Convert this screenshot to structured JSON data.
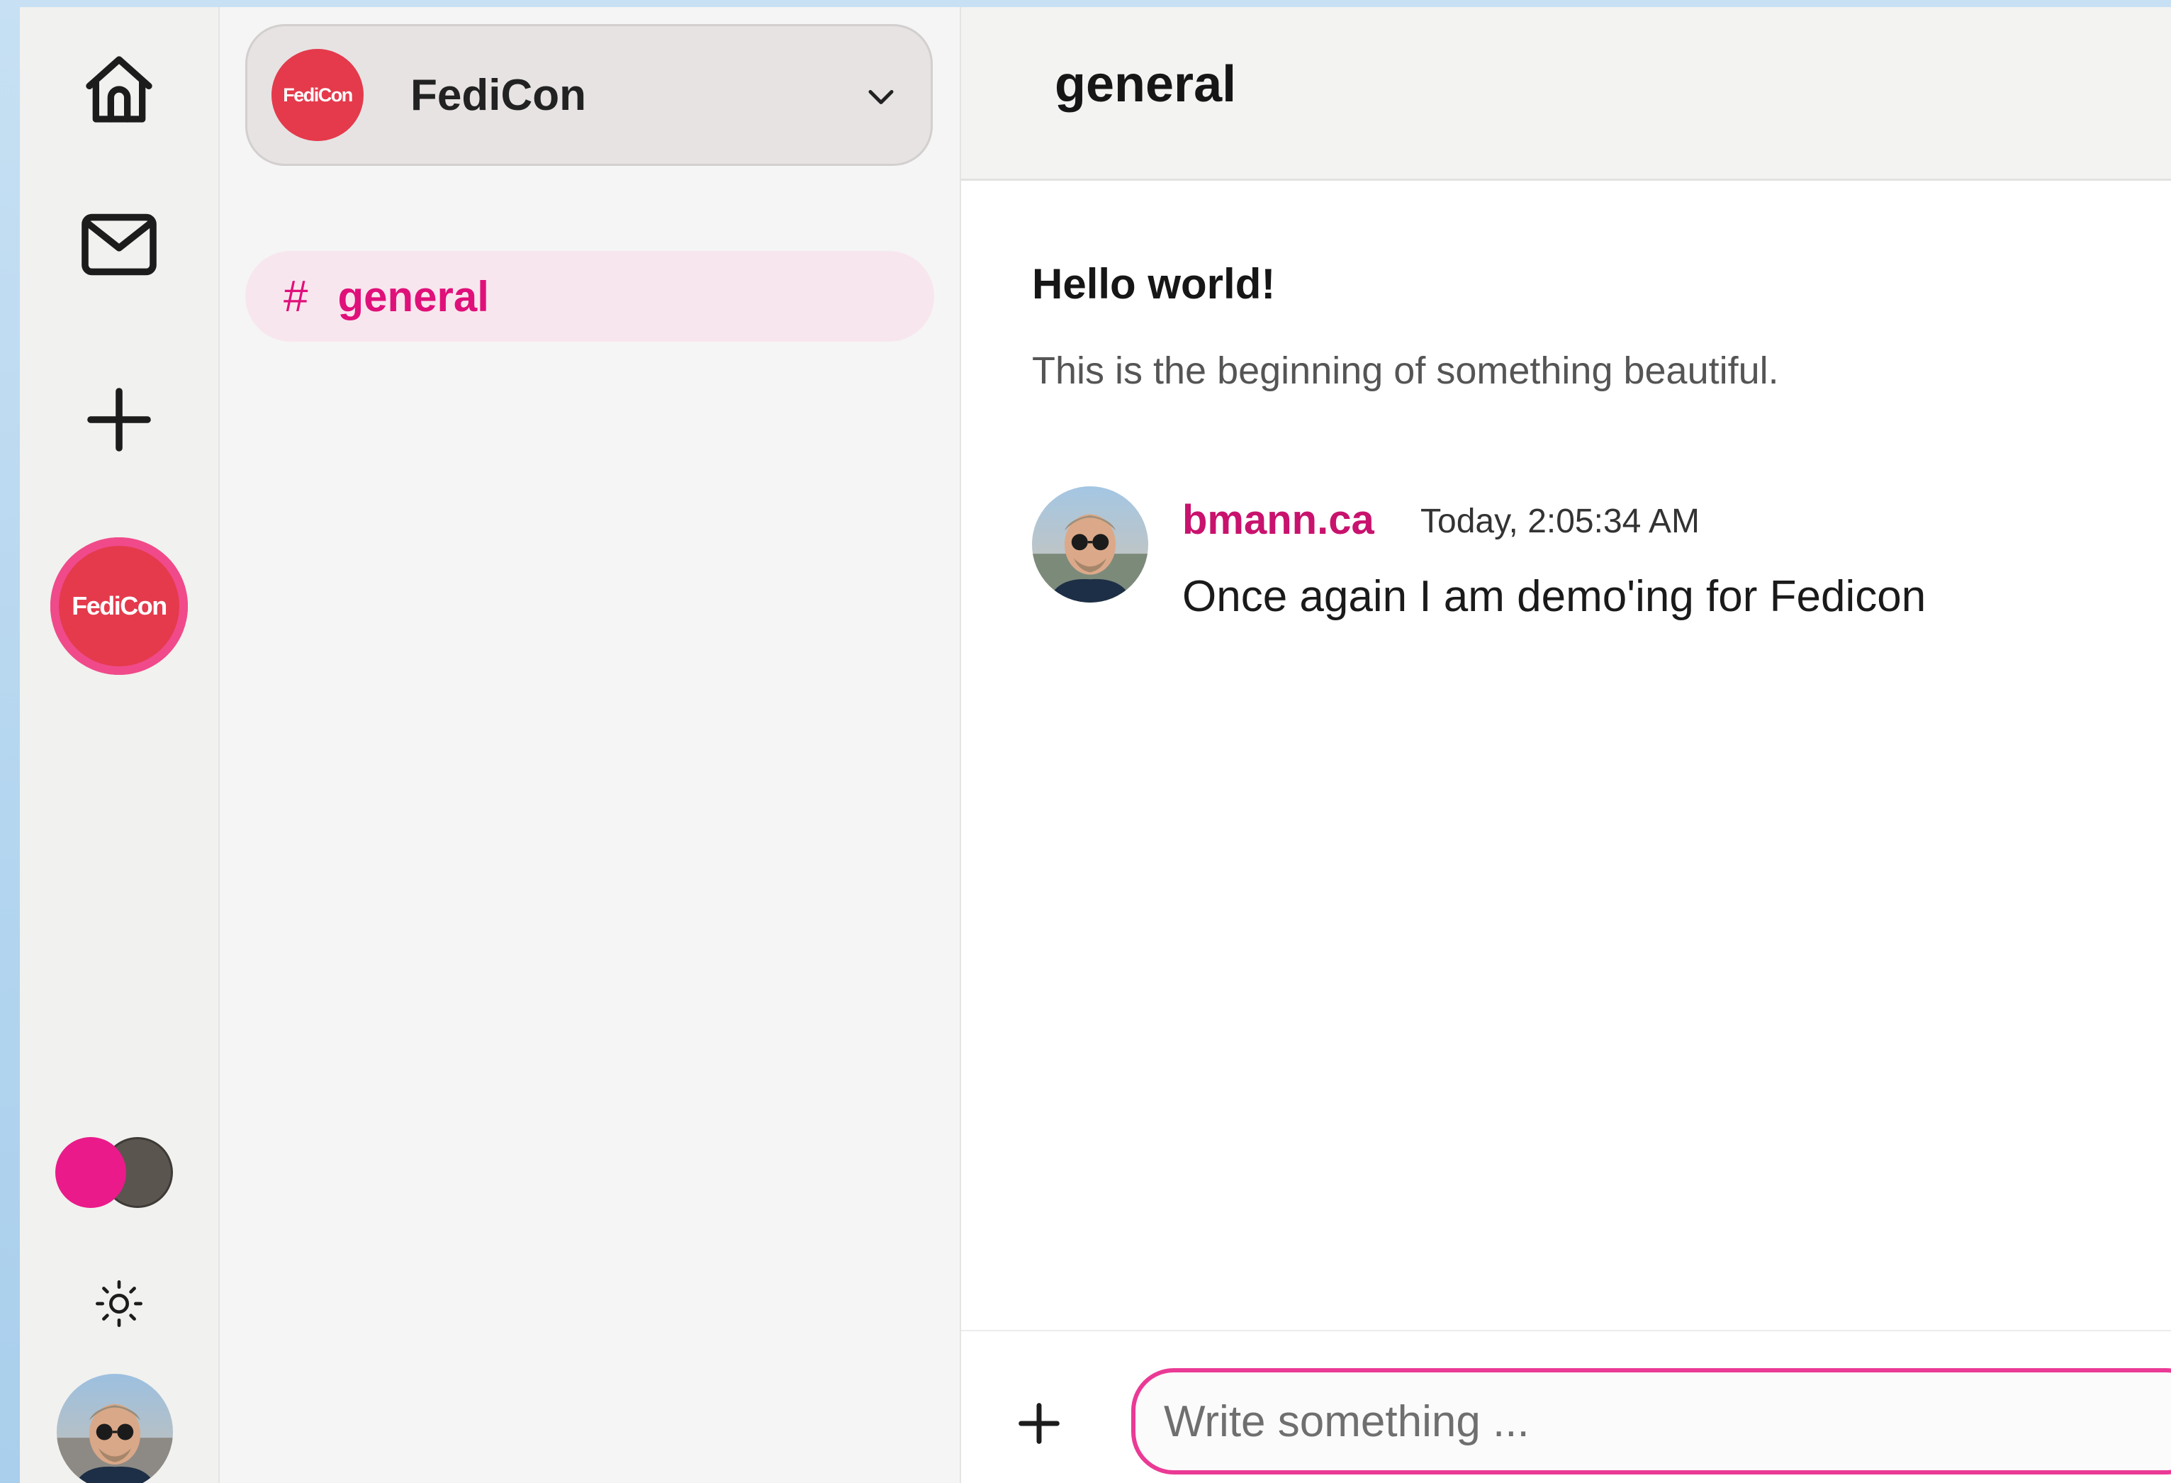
{
  "colors": {
    "accent": "#e0107a",
    "brand_red": "#e43a4c",
    "input_border": "#ea3a95"
  },
  "rail": {
    "icons": [
      "home-icon",
      "mail-icon",
      "plus-icon"
    ],
    "server_logo_text": "FediCon",
    "theme_colors": [
      "#ea1a8a",
      "#5b5550"
    ],
    "settings_icon": "sun-icon"
  },
  "sidebar": {
    "server_name": "FediCon",
    "server_logo_text": "FediCon",
    "channels": [
      {
        "hash": "#",
        "name": "general",
        "active": true
      }
    ]
  },
  "main": {
    "title": "general",
    "welcome_title": "Hello world!",
    "welcome_subtitle": "This is the beginning of something beautiful.",
    "messages": [
      {
        "author": "bmann.ca",
        "time": "Today, 2:05:34 AM",
        "text": "Once again I am demo'ing for Fedicon"
      }
    ],
    "composer": {
      "placeholder": "Write something ..."
    }
  }
}
